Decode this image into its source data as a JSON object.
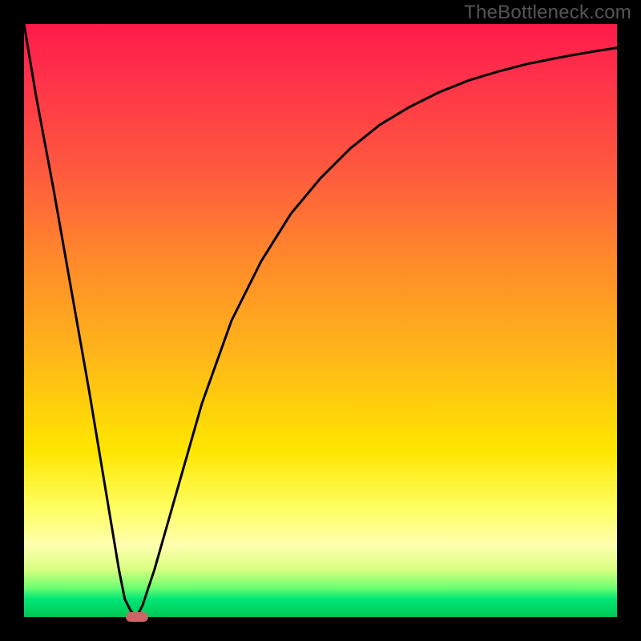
{
  "watermark": "TheBottleneck.com",
  "chart_data": {
    "type": "line",
    "title": "",
    "xlabel": "",
    "ylabel": "",
    "xlim": [
      0,
      100
    ],
    "ylim": [
      0,
      100
    ],
    "grid": false,
    "legend": false,
    "series": [
      {
        "name": "bottleneck-curve",
        "x": [
          0,
          2,
          5,
          8,
          11,
          14,
          16,
          17,
          18,
          19,
          20,
          22,
          24,
          26,
          30,
          35,
          40,
          45,
          50,
          55,
          60,
          65,
          70,
          75,
          80,
          85,
          90,
          95,
          100
        ],
        "y": [
          100,
          88,
          72,
          55,
          38,
          20,
          8,
          3,
          1,
          0,
          2,
          8,
          15,
          22,
          36,
          50,
          60,
          68,
          74,
          79,
          83,
          86,
          88.5,
          90.5,
          92,
          93.3,
          94.3,
          95.2,
          96
        ]
      }
    ],
    "optimum_marker": {
      "x": 19,
      "y": 0,
      "color": "#cc6666"
    },
    "background_gradient": {
      "top": "#ff1a4a",
      "mid1": "#ff8a2a",
      "mid2": "#ffe600",
      "bottom": "#00c853"
    }
  }
}
